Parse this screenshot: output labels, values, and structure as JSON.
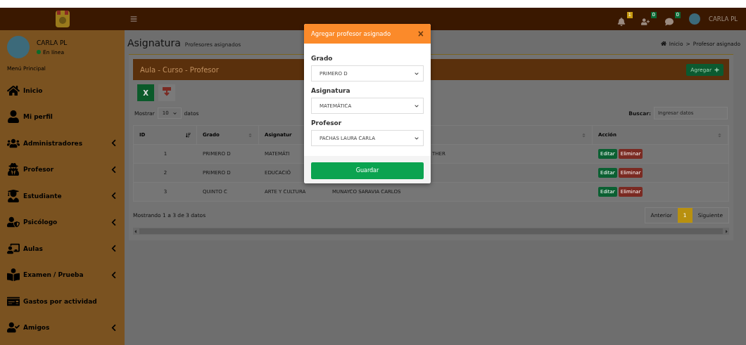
{
  "brand": {
    "kind": "crest"
  },
  "user": {
    "name": "CARLA PL",
    "status": "En línea",
    "online": true
  },
  "sidebar": {
    "heading": "Menú Principal",
    "items": [
      {
        "label": "Inicio",
        "expandable": false
      },
      {
        "label": "Mi perfil",
        "expandable": false
      },
      {
        "label": "Administradores",
        "expandable": true
      },
      {
        "label": "Profesor",
        "expandable": true
      },
      {
        "label": "Estudiante",
        "expandable": true
      },
      {
        "label": "Psicólogo",
        "expandable": true
      },
      {
        "label": "Aulas",
        "expandable": true
      },
      {
        "label": "Examen / Prueba",
        "expandable": true
      },
      {
        "label": "Gastos por actividad",
        "expandable": false
      },
      {
        "label": "Amigos",
        "expandable": true
      }
    ]
  },
  "topbar": {
    "notifications": [
      {
        "count": "1",
        "color": "#c79a10"
      },
      {
        "count": "0",
        "color": "#0b6b36"
      },
      {
        "count": "0",
        "color": "#0b6b36"
      }
    ],
    "user_name": "CARLA PL"
  },
  "page": {
    "title": "Asignatura",
    "subtitle": "Profesores asignados",
    "breadcrumb": [
      "Inicio",
      "Profesor asignado"
    ],
    "breadcrumb_separator": ">"
  },
  "panel": {
    "title": "Aula - Curso - Profesor",
    "add_button": "Agregar",
    "exports": [
      {
        "kind": "excel",
        "glyph": "X"
      },
      {
        "kind": "pdf"
      }
    ],
    "length": {
      "prefix": "Mostrar",
      "value": "10",
      "suffix": "datos"
    },
    "search": {
      "label": "Buscar:",
      "placeholder": "Ingresar datos"
    },
    "table": {
      "columns": [
        {
          "label": "ID",
          "sorted": true
        },
        {
          "label": "Grado",
          "sorted": false
        },
        {
          "label": "Asignatur"
        },
        {
          "sorted": false
        },
        {
          "label": "Acción",
          "sorted": false
        }
      ],
      "rows": [
        {
          "cells": [
            {
              "text": "1",
              "kind": "num"
            },
            {
              "text": "PRIMERO D",
              "kind": "text"
            },
            {
              "text": "MATEMÁTI",
              "kind": "text"
            },
            {
              "text": "THER",
              "kind": "partial"
            }
          ],
          "actions": [
            "Editar",
            "Eliminar"
          ]
        },
        {
          "cells": [
            {
              "text": "2",
              "kind": "num"
            },
            {
              "text": "PRIMERO D",
              "kind": "text"
            },
            {
              "text": "EDUCACIÓ",
              "kind": "text"
            },
            {
              "kind": "empty"
            }
          ],
          "actions": [
            "Editar",
            "Eliminar"
          ]
        },
        {
          "cells": [
            {
              "text": "3",
              "kind": "num"
            },
            {
              "text": "QUINTO C",
              "kind": "text"
            },
            {
              "text": "ARTE Y CULTURA",
              "kind": "text"
            },
            {
              "text": "MUNAYCO SARAVIA CARLOS",
              "kind": "text"
            }
          ],
          "actions": [
            "Editar",
            "Eliminar"
          ]
        }
      ]
    },
    "info": "Mostrando 1 a 3 de 3 datos",
    "pagination": [
      {
        "label": "Anterior",
        "selected": false
      },
      {
        "label": "1",
        "selected": true
      },
      {
        "label": "Siguiente",
        "selected": false
      }
    ]
  },
  "modal": {
    "title": "Agregar profesor asignado",
    "close": "×",
    "fields": [
      {
        "label": "Grado",
        "value": "PRIMERO D"
      },
      {
        "label": "Asignatura",
        "value": "MATEMÁTICA"
      },
      {
        "label": "Profesor",
        "value": "PACHAS LAURA CARLA"
      }
    ],
    "submit": "Guardar"
  }
}
